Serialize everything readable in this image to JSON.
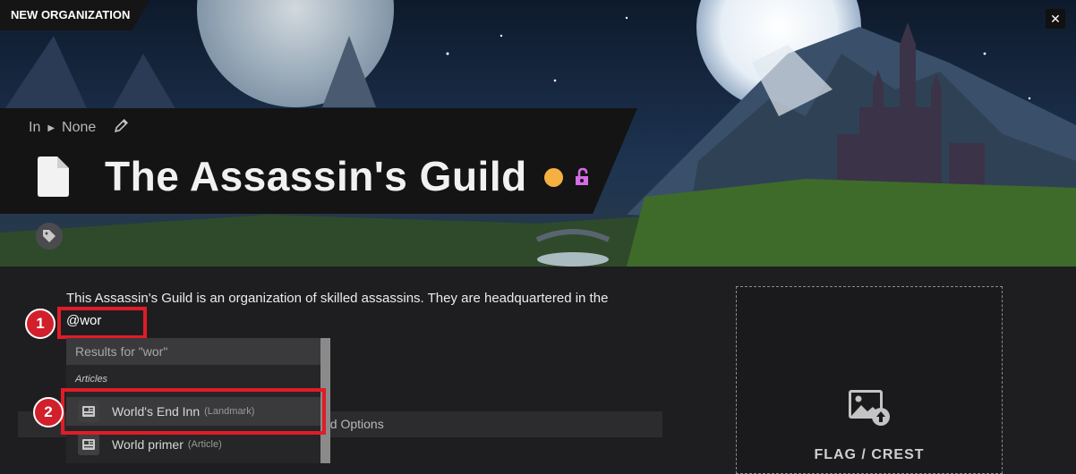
{
  "header": {
    "corner_label": "NEW ORGANIZATION",
    "close_glyph": "✕"
  },
  "breadcrumb": {
    "prefix": "In",
    "value": "None"
  },
  "article": {
    "title": "The Assassin's Guild"
  },
  "content": {
    "text": "This Assassin's Guild is an organization of skilled assassins. They are headquartered in the",
    "mention_input": "@wor"
  },
  "dropdown": {
    "header": "Results for \"wor\"",
    "section": "Articles",
    "items": [
      {
        "title": "World's End Inn",
        "type": "(Landmark)"
      },
      {
        "title": "World primer",
        "type": "(Article)"
      }
    ]
  },
  "options": {
    "label": "ed Options"
  },
  "crest": {
    "label": "FLAG / CREST"
  },
  "markers": [
    "1",
    "2"
  ],
  "colors": {
    "status_dot": "#f5b041",
    "lock": "#d66ce6",
    "highlight": "#e01c27",
    "marker": "#d1202b"
  },
  "icons": [
    "document-icon",
    "pencil-icon",
    "lock-open-icon",
    "tag-icon",
    "newspaper-icon",
    "image-upload-icon",
    "close-icon"
  ]
}
